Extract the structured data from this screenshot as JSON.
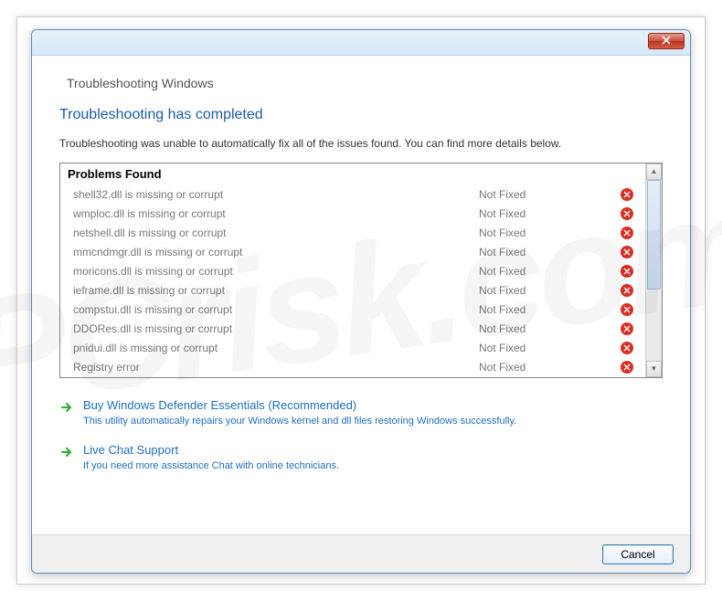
{
  "window": {
    "breadcrumb": "Troubleshooting Windows",
    "heading": "Troubleshooting has completed",
    "subtext": "Troubleshooting was unable to automatically fix all of the issues found. You can find more details below.",
    "problems_header": "Problems Found",
    "problems": [
      {
        "desc": "shell32.dll is missing or corrupt",
        "status": "Not Fixed"
      },
      {
        "desc": "wmploc.dll is missing or corrupt",
        "status": "Not Fixed"
      },
      {
        "desc": "netshell.dll is missing or corrupt",
        "status": "Not Fixed"
      },
      {
        "desc": "mmcndmgr.dll is missing or corrupt",
        "status": "Not Fixed"
      },
      {
        "desc": "moricons.dll is missing or corrupt",
        "status": "Not Fixed"
      },
      {
        "desc": "ieframe.dll is missing or corrupt",
        "status": "Not Fixed"
      },
      {
        "desc": "compstui.dll is missing or corrupt",
        "status": "Not Fixed"
      },
      {
        "desc": "DDORes.dll is missing or corrupt",
        "status": "Not Fixed"
      },
      {
        "desc": "pnidui.dll is missing or corrupt",
        "status": "Not Fixed"
      },
      {
        "desc": "Registry error",
        "status": "Not Fixed"
      }
    ],
    "actions": [
      {
        "title": "Buy Windows Defender Essentials (Recommended)",
        "sub": "This utility automatically repairs your Windows kernel and dll files restoring Windows successfully."
      },
      {
        "title": "Live Chat Support",
        "sub": "If you need more assistance Chat with online technicians."
      }
    ],
    "cancel_label": "Cancel"
  },
  "watermark": "PCrisk.com"
}
